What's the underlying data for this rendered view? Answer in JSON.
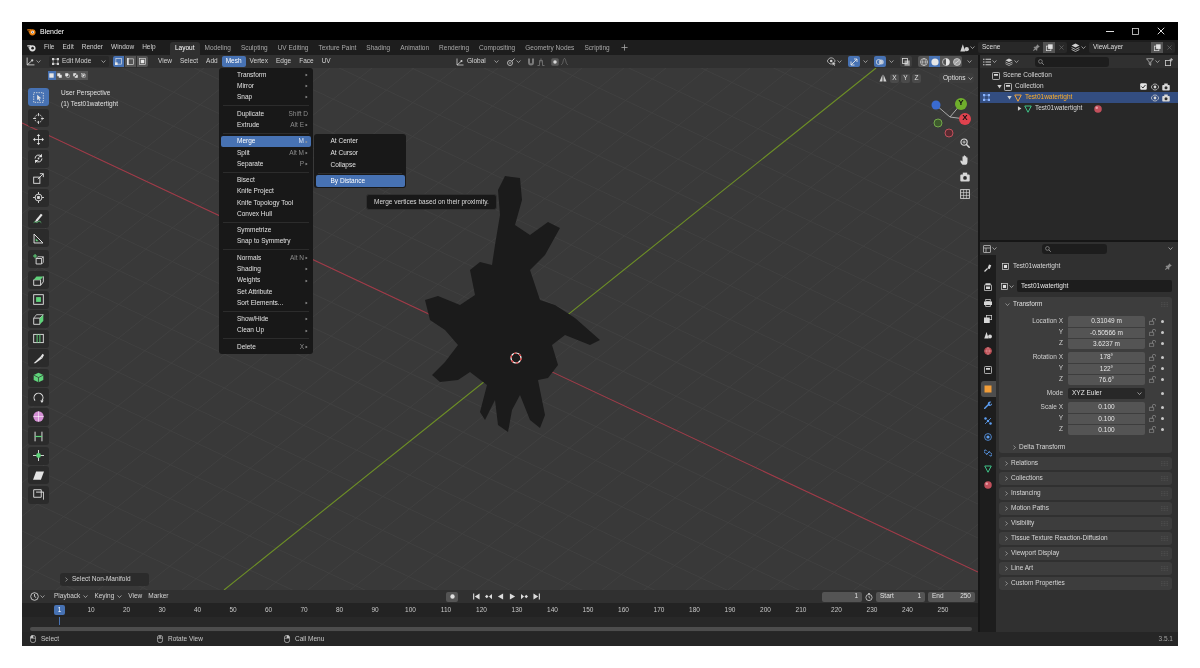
{
  "window": {
    "title": "Blender"
  },
  "top_bar": {
    "menus": [
      "File",
      "Edit",
      "Render",
      "Window",
      "Help"
    ],
    "workspaces": [
      {
        "label": "Layout",
        "selected": true
      },
      {
        "label": "Modeling",
        "selected": false
      },
      {
        "label": "Sculpting",
        "selected": false
      },
      {
        "label": "UV Editing",
        "selected": false
      },
      {
        "label": "Texture Paint",
        "selected": false
      },
      {
        "label": "Shading",
        "selected": false
      },
      {
        "label": "Animation",
        "selected": false
      },
      {
        "label": "Rendering",
        "selected": false
      },
      {
        "label": "Compositing",
        "selected": false
      },
      {
        "label": "Geometry Nodes",
        "selected": false
      },
      {
        "label": "Scripting",
        "selected": false
      }
    ],
    "scene": "Scene",
    "view_layer": "ViewLayer"
  },
  "viewport_header": {
    "mode": "Edit Mode",
    "select_modes": [
      {
        "kind": "vertex",
        "selected": true
      },
      {
        "kind": "edge",
        "selected": false
      },
      {
        "kind": "face",
        "selected": false
      }
    ],
    "menus": [
      {
        "label": "View",
        "selected": false
      },
      {
        "label": "Select",
        "selected": false
      },
      {
        "label": "Add",
        "selected": false
      },
      {
        "label": "Mesh",
        "selected": true
      },
      {
        "label": "Vertex",
        "selected": false
      },
      {
        "label": "Edge",
        "selected": false
      },
      {
        "label": "Face",
        "selected": false
      },
      {
        "label": "UV",
        "selected": false
      }
    ],
    "orientation": "Global",
    "toggles": [
      {
        "kind": "gizmos",
        "on": true
      },
      {
        "kind": "overlays",
        "on": true
      },
      {
        "kind": "xray",
        "on": false
      }
    ],
    "shading_modes": [
      {
        "kind": "wireframe",
        "selected": false
      },
      {
        "kind": "solid",
        "selected": true
      },
      {
        "kind": "material",
        "selected": false
      },
      {
        "kind": "rendered",
        "selected": false
      }
    ]
  },
  "tool_header": {
    "selection_modes": [
      {
        "kind": "set",
        "selected": true
      },
      {
        "kind": "extend",
        "selected": false
      },
      {
        "kind": "subtract",
        "selected": false
      },
      {
        "kind": "difference",
        "selected": false
      },
      {
        "kind": "intersect",
        "selected": false
      }
    ],
    "axes": [
      "X",
      "Y",
      "Z"
    ],
    "options": "Options"
  },
  "viewport": {
    "view_name": "User Perspective",
    "object_label": "(1) Test01watertight",
    "gizmo_labels": [
      "Y",
      "X"
    ]
  },
  "toolbar": {
    "tool_groups": [
      [
        {
          "kind": "select_box",
          "selected": true
        }
      ],
      [
        {
          "kind": "cursor",
          "selected": false
        }
      ],
      [
        {
          "kind": "move",
          "selected": false
        },
        {
          "kind": "rotate",
          "selected": false
        },
        {
          "kind": "scale",
          "selected": false
        },
        {
          "kind": "transform",
          "selected": false
        }
      ],
      [
        {
          "kind": "annotate",
          "selected": false
        },
        {
          "kind": "measure",
          "selected": false
        }
      ],
      [
        {
          "kind": "add_cube",
          "selected": false
        }
      ],
      [
        {
          "kind": "extrude",
          "selected": false
        },
        {
          "kind": "inset",
          "selected": false
        },
        {
          "kind": "bevel",
          "selected": false
        },
        {
          "kind": "loop_cut",
          "selected": false
        },
        {
          "kind": "knife",
          "selected": false
        },
        {
          "kind": "poly_build",
          "selected": false
        },
        {
          "kind": "spin",
          "selected": false
        },
        {
          "kind": "smooth",
          "selected": false
        },
        {
          "kind": "edge_slide",
          "selected": false
        },
        {
          "kind": "shrink_fatten",
          "selected": false
        },
        {
          "kind": "shear",
          "selected": false
        },
        {
          "kind": "rip",
          "selected": false
        }
      ]
    ]
  },
  "mesh_menu": {
    "groups": [
      [
        {
          "label": "Transform",
          "submenu": true,
          "selected": false
        },
        {
          "label": "Mirror",
          "submenu": true,
          "selected": false
        },
        {
          "label": "Snap",
          "submenu": true,
          "selected": false
        }
      ],
      [
        {
          "label": "Duplicate",
          "shortcut": "Shift D",
          "submenu": false,
          "selected": false
        },
        {
          "label": "Extrude",
          "shortcut": "Alt E",
          "submenu": true,
          "selected": false
        }
      ],
      [
        {
          "label": "Merge",
          "shortcut": "M",
          "submenu": true,
          "selected": true
        },
        {
          "label": "Split",
          "shortcut": "Alt M",
          "submenu": true,
          "selected": false
        },
        {
          "label": "Separate",
          "shortcut": "P",
          "submenu": true,
          "selected": false
        }
      ],
      [
        {
          "label": "Bisect",
          "submenu": false,
          "selected": false
        },
        {
          "label": "Knife Project",
          "submenu": false,
          "selected": false
        },
        {
          "label": "Knife Topology Tool",
          "submenu": false,
          "selected": false
        },
        {
          "label": "Convex Hull",
          "submenu": false,
          "selected": false
        }
      ],
      [
        {
          "label": "Symmetrize",
          "submenu": false,
          "selected": false
        },
        {
          "label": "Snap to Symmetry",
          "submenu": false,
          "selected": false
        }
      ],
      [
        {
          "label": "Normals",
          "shortcut": "Alt N",
          "submenu": true,
          "selected": false
        },
        {
          "label": "Shading",
          "submenu": true,
          "selected": false
        },
        {
          "label": "Weights",
          "submenu": true,
          "selected": false
        },
        {
          "label": "Set Attribute",
          "submenu": false,
          "selected": false
        },
        {
          "label": "Sort Elements...",
          "submenu": true,
          "selected": false
        }
      ],
      [
        {
          "label": "Show/Hide",
          "submenu": true,
          "selected": false
        },
        {
          "label": "Clean Up",
          "submenu": true,
          "selected": false
        }
      ],
      [
        {
          "label": "Delete",
          "shortcut": "X",
          "submenu": true,
          "selected": false
        }
      ]
    ]
  },
  "merge_submenu": {
    "groups": [
      [
        {
          "label": "At Center",
          "selected": false
        },
        {
          "label": "At Cursor",
          "selected": false
        },
        {
          "label": "Collapse",
          "selected": false
        }
      ],
      [
        {
          "label": "By Distance",
          "selected": true
        }
      ]
    ]
  },
  "tooltip": "Merge vertices based on their proximity.",
  "last_operator": {
    "label": "Select Non-Manifold",
    "expanded": false
  },
  "outliner": {
    "tree": [
      {
        "kind": "scene_collection",
        "label": "Scene Collection",
        "selected": false,
        "edit_mode": false,
        "children": [
          {
            "kind": "collection",
            "label": "Collection",
            "expanded": true,
            "checked": true,
            "selected": false,
            "edit_mode": false,
            "children": [
              {
                "kind": "object",
                "label": "Test01watertight",
                "expanded": true,
                "selected": true,
                "edit_mode": true,
                "children": [
                  {
                    "kind": "mesh",
                    "label": "Test01watertight",
                    "expanded": false,
                    "selected": false,
                    "edit_mode": false
                  }
                ]
              }
            ]
          }
        ]
      }
    ]
  },
  "properties": {
    "tab_groups": [
      [
        {
          "kind": "tool",
          "selected": false
        }
      ],
      [
        {
          "kind": "render",
          "selected": false
        },
        {
          "kind": "output",
          "selected": false
        },
        {
          "kind": "view_layer",
          "selected": false
        },
        {
          "kind": "scene",
          "selected": false
        },
        {
          "kind": "world",
          "selected": false
        }
      ],
      [
        {
          "kind": "collection",
          "selected": false
        }
      ],
      [
        {
          "kind": "object",
          "selected": true
        },
        {
          "kind": "modifiers",
          "selected": false
        },
        {
          "kind": "particles",
          "selected": false
        },
        {
          "kind": "physics",
          "selected": false
        },
        {
          "kind": "constraints",
          "selected": false
        },
        {
          "kind": "data",
          "selected": false
        },
        {
          "kind": "material",
          "selected": false
        }
      ]
    ],
    "object_name": "Test01watertight",
    "name_field": "Test01watertight",
    "transform": {
      "label": "Transform",
      "expanded": true,
      "groups": [
        [
          {
            "kind": "number",
            "label": "Location X",
            "value": "0.31049 m"
          },
          {
            "kind": "number",
            "label": "Y",
            "value": "-0.50566 m"
          },
          {
            "kind": "number",
            "label": "Z",
            "value": "3.6237 m"
          }
        ],
        [
          {
            "kind": "number",
            "label": "Rotation X",
            "value": "178°"
          },
          {
            "kind": "number",
            "label": "Y",
            "value": "122°"
          },
          {
            "kind": "number",
            "label": "Z",
            "value": "76.6°"
          }
        ],
        [
          {
            "kind": "dropdown",
            "label": "Mode",
            "value": "XYZ Euler"
          }
        ],
        [
          {
            "kind": "number",
            "label": "Scale X",
            "value": "0.100"
          },
          {
            "kind": "number",
            "label": "Y",
            "value": "0.100"
          },
          {
            "kind": "number",
            "label": "Z",
            "value": "0.100"
          }
        ]
      ],
      "subpanel": {
        "label": "Delta Transform",
        "expanded": false
      }
    },
    "panels": [
      {
        "label": "Relations",
        "expanded": false
      },
      {
        "label": "Collections",
        "expanded": false
      },
      {
        "label": "Instancing",
        "expanded": false
      },
      {
        "label": "Motion Paths",
        "expanded": false
      },
      {
        "label": "Visibility",
        "expanded": false
      },
      {
        "label": "Tissue Texture Reaction-Diffusion",
        "expanded": false
      },
      {
        "label": "Viewport Display",
        "expanded": false
      },
      {
        "label": "Line Art",
        "expanded": false
      },
      {
        "label": "Custom Properties",
        "expanded": false
      }
    ]
  },
  "timeline": {
    "menus": [
      {
        "label": "Playback",
        "kind": "dropdown"
      },
      {
        "label": "Keying",
        "kind": "dropdown"
      },
      {
        "label": "View",
        "kind": "menu"
      },
      {
        "label": "Marker",
        "kind": "menu"
      }
    ],
    "current_frame": "1",
    "start": {
      "label": "Start",
      "value": "1"
    },
    "end": {
      "label": "End",
      "value": "250"
    },
    "playhead": "1",
    "frame_labels": [
      "10",
      "20",
      "30",
      "40",
      "50",
      "60",
      "70",
      "80",
      "90",
      "100",
      "110",
      "120",
      "130",
      "140",
      "150",
      "160",
      "170",
      "180",
      "190",
      "200",
      "210",
      "220",
      "230",
      "240",
      "250"
    ]
  },
  "status_bar": {
    "hints": [
      {
        "kind": "left",
        "label": "Select"
      },
      {
        "kind": "middle",
        "label": "Rotate View"
      },
      {
        "kind": "right",
        "label": "Call Menu"
      }
    ],
    "version": "3.5.1"
  }
}
